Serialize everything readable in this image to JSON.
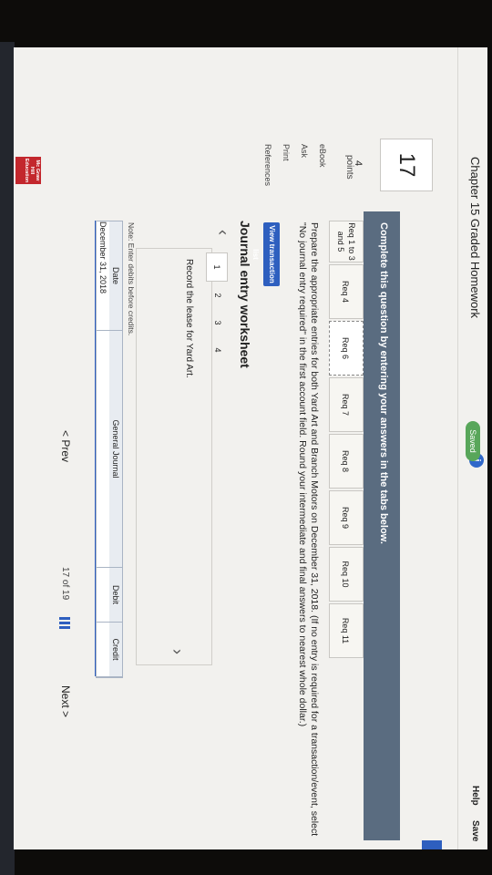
{
  "header": {
    "chapter_title": "Chapter 15 Graded Homework",
    "info_icon": "i",
    "saved_label": "Saved",
    "help_label": "Help",
    "save_label": "Save"
  },
  "question": {
    "number": "17",
    "points_value": "4",
    "points_label": "points"
  },
  "side_links": [
    "eBook",
    "Ask",
    "Print",
    "References"
  ],
  "instruction": "Complete this question by entering your answers in the tabs below.",
  "tabs": [
    {
      "label": "Req 1 to 3 and 5"
    },
    {
      "label": "Req 4"
    },
    {
      "label": "Req 6"
    },
    {
      "label": "Req 7"
    },
    {
      "label": "Req 8"
    },
    {
      "label": "Req 9"
    },
    {
      "label": "Req 10"
    },
    {
      "label": "Req 11"
    }
  ],
  "prompt": "Prepare the appropriate entries for both Yard Art and Branch Motors on December 31, 2018. (If no entry is required for a transaction/event, select \"No journal entry required\" in the first account field. Round your intermediate and final answers to nearest whole dollar.)",
  "view_transaction_list": "View transaction list",
  "worksheet": {
    "title": "Journal entry worksheet",
    "pages": [
      "1",
      "2",
      "3",
      "4"
    ],
    "record_text": "Record the lease for Yard Art.",
    "note": "Note: Enter debits before credits."
  },
  "journal": {
    "headers": [
      "Date",
      "General Journal",
      "Debit",
      "Credit"
    ],
    "row_date": "December 31, 2018"
  },
  "navigation": {
    "prev": "< Prev",
    "page_indicator": "17 of 19",
    "next": "Next >"
  },
  "logo_text": "Mc Graw Hill Education",
  "colors": {
    "accent": "#2e5fbf",
    "saved": "#58a65a",
    "instruction_band": "#5a6c80",
    "logo": "#c3272d"
  }
}
